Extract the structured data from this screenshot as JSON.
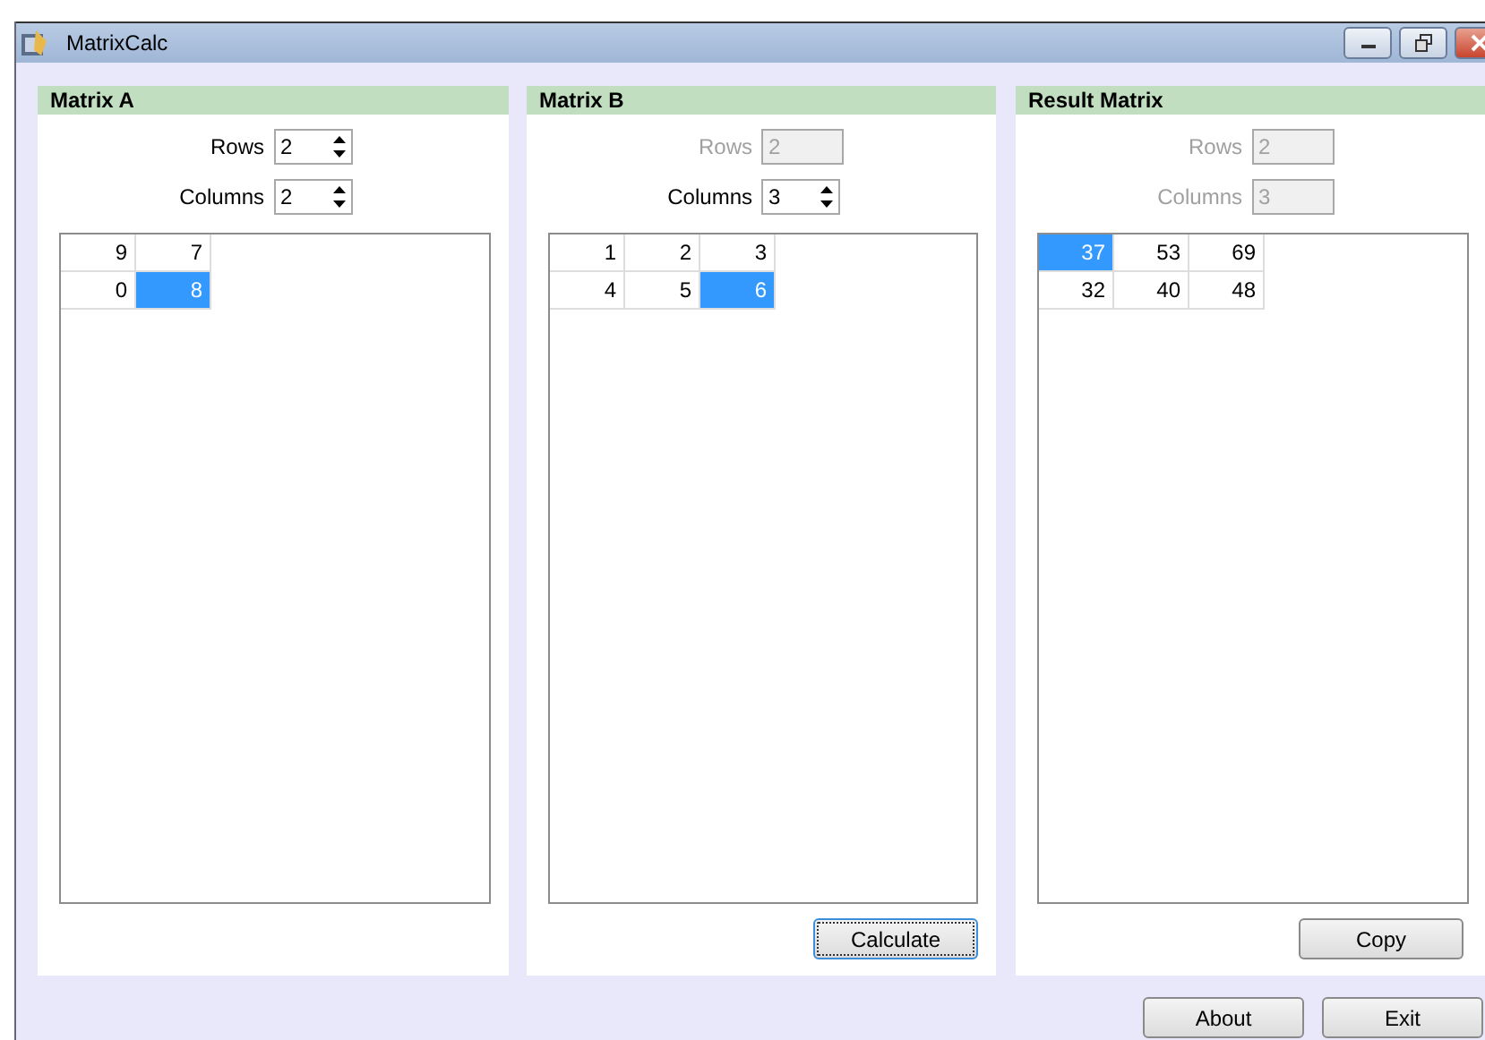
{
  "window": {
    "title": "MatrixCalc"
  },
  "panels": [
    {
      "title": "Matrix A",
      "rows_field": {
        "label": "Rows",
        "value": "2",
        "disabled": false
      },
      "columns_field": {
        "label": "Columns",
        "value": "2",
        "disabled": false
      },
      "grid": [
        [
          {
            "value": "9",
            "selected": false
          },
          {
            "value": "7",
            "selected": false
          }
        ],
        [
          {
            "value": "0",
            "selected": false
          },
          {
            "value": "8",
            "selected": true
          }
        ]
      ]
    },
    {
      "title": "Matrix B",
      "rows_field": {
        "label": "Rows",
        "value": "2",
        "disabled": true
      },
      "columns_field": {
        "label": "Columns",
        "value": "3",
        "disabled": false
      },
      "grid": [
        [
          {
            "value": "1",
            "selected": false
          },
          {
            "value": "2",
            "selected": false
          },
          {
            "value": "3",
            "selected": false
          }
        ],
        [
          {
            "value": "4",
            "selected": false
          },
          {
            "value": "5",
            "selected": false
          },
          {
            "value": "6",
            "selected": true
          }
        ]
      ],
      "button": {
        "label": "Calculate",
        "focused": true
      }
    },
    {
      "title": "Result Matrix",
      "rows_field": {
        "label": "Rows",
        "value": "2",
        "disabled": true
      },
      "columns_field": {
        "label": "Columns",
        "value": "3",
        "disabled": true
      },
      "grid": [
        [
          {
            "value": "37",
            "selected": true
          },
          {
            "value": "53",
            "selected": false
          },
          {
            "value": "69",
            "selected": false
          }
        ],
        [
          {
            "value": "32",
            "selected": false
          },
          {
            "value": "40",
            "selected": false
          },
          {
            "value": "48",
            "selected": false
          }
        ]
      ],
      "button": {
        "label": "Copy",
        "focused": false
      }
    }
  ],
  "footer_buttons": [
    "About",
    "Exit"
  ]
}
